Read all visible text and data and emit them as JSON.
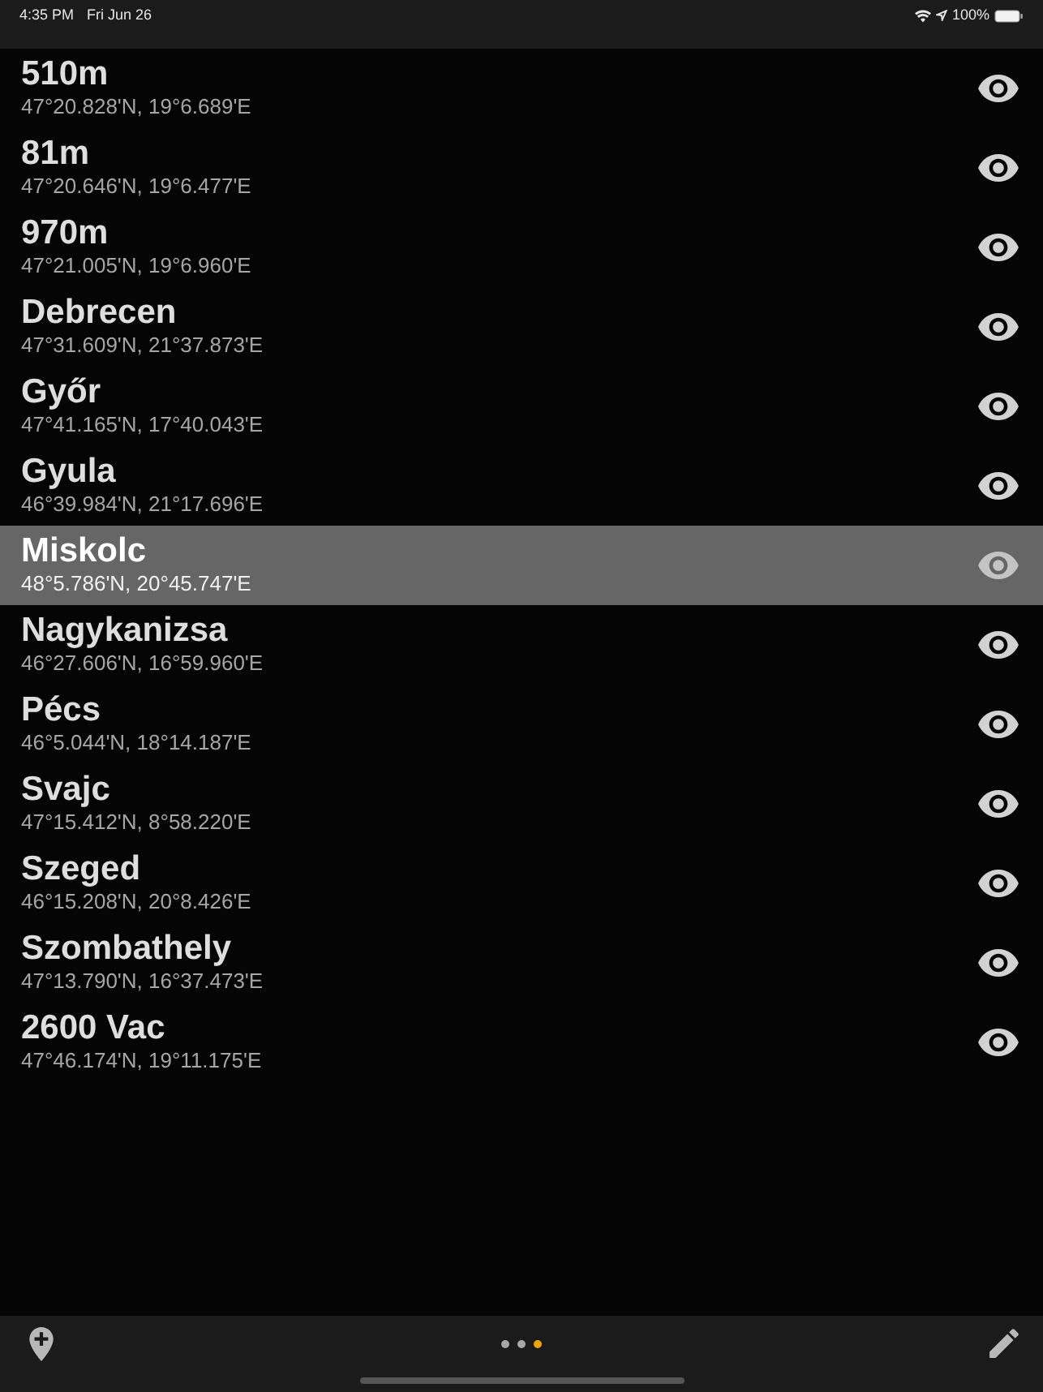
{
  "status_bar": {
    "time": "4:35 PM",
    "date": "Fri Jun 26",
    "battery": "100%"
  },
  "locations": [
    {
      "name": "510m",
      "coords": "47°20.828'N, 19°6.689'E",
      "selected": false
    },
    {
      "name": "81m",
      "coords": "47°20.646'N, 19°6.477'E",
      "selected": false
    },
    {
      "name": "970m",
      "coords": "47°21.005'N, 19°6.960'E",
      "selected": false
    },
    {
      "name": "Debrecen",
      "coords": "47°31.609'N, 21°37.873'E",
      "selected": false
    },
    {
      "name": "Győr",
      "coords": "47°41.165'N, 17°40.043'E",
      "selected": false
    },
    {
      "name": "Gyula",
      "coords": "46°39.984'N, 21°17.696'E",
      "selected": false
    },
    {
      "name": "Miskolc",
      "coords": "48°5.786'N, 20°45.747'E",
      "selected": true
    },
    {
      "name": "Nagykanizsa",
      "coords": "46°27.606'N, 16°59.960'E",
      "selected": false
    },
    {
      "name": "Pécs",
      "coords": "46°5.044'N, 18°14.187'E",
      "selected": false
    },
    {
      "name": "Svajc",
      "coords": "47°15.412'N, 8°58.220'E",
      "selected": false
    },
    {
      "name": "Szeged",
      "coords": "46°15.208'N, 20°8.426'E",
      "selected": false
    },
    {
      "name": "Szombathely",
      "coords": "47°13.790'N, 16°37.473'E",
      "selected": false
    },
    {
      "name": "2600 Vac",
      "coords": "47°46.174'N, 19°11.175'E",
      "selected": false
    }
  ],
  "page_dots": [
    {
      "selected": false
    },
    {
      "selected": false
    },
    {
      "selected": true
    }
  ]
}
